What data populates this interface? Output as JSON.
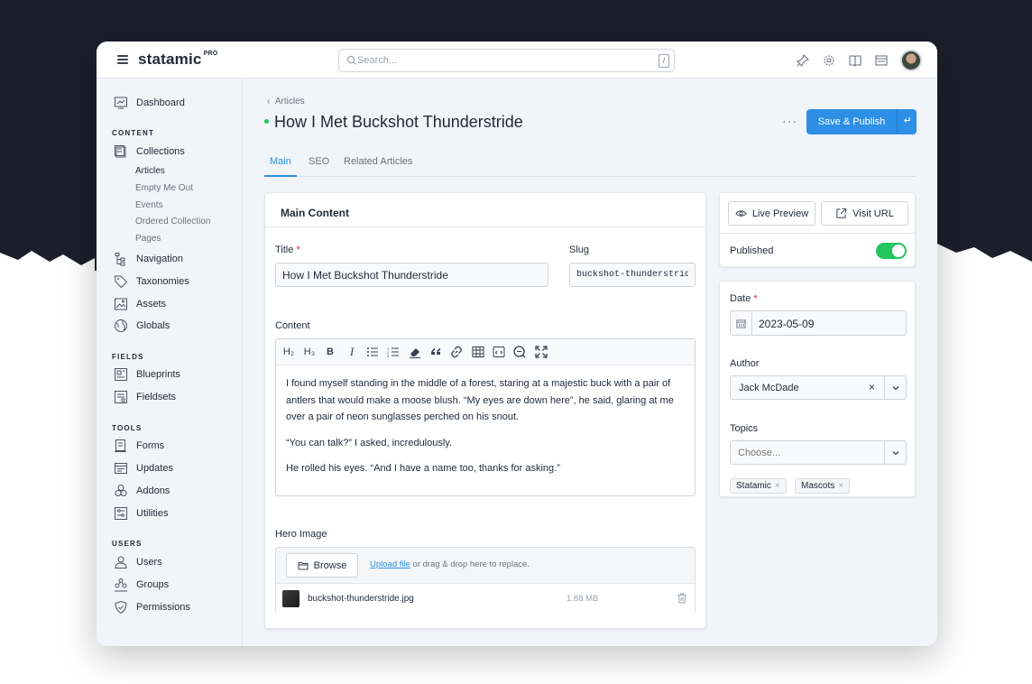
{
  "brand": {
    "name": "statamic",
    "edition": "PRO"
  },
  "search": {
    "placeholder": "Search...",
    "shortcut": "/"
  },
  "header": {
    "icons": [
      "pin-icon",
      "gear-icon",
      "book-icon",
      "site-icon",
      "avatar"
    ]
  },
  "sidebar": {
    "dashboard": "Dashboard",
    "sections": {
      "content": "CONTENT",
      "fields": "FIELDS",
      "tools": "TOOLS",
      "users": "USERS"
    },
    "collections": "Collections",
    "collection_items": [
      "Articles",
      "Empty Me Out",
      "Events",
      "Ordered Collection",
      "Pages"
    ],
    "navigation": "Navigation",
    "taxonomies": "Taxonomies",
    "assets": "Assets",
    "globals": "Globals",
    "blueprints": "Blueprints",
    "fieldsets": "Fieldsets",
    "forms": "Forms",
    "updates": "Updates",
    "addons": "Addons",
    "utilities": "Utilities",
    "users": "Users",
    "groups": "Groups",
    "permissions": "Permissions"
  },
  "page": {
    "breadcrumb": "Articles",
    "title": "How I Met Buckshot Thunderstride",
    "more": "···",
    "publish_label": "Save & Publish",
    "status_color": "#22c55e"
  },
  "tabs": [
    "Main",
    "SEO",
    "Related Articles"
  ],
  "main_card": {
    "title": "Main Content",
    "title_label": "Title",
    "title_value": "How I Met Buckshot Thunderstride",
    "slug_label": "Slug",
    "slug_value": "buckshot-thunderstride",
    "content_label": "Content",
    "toolbar_labels": [
      "H₂",
      "H₃",
      "B",
      "I"
    ],
    "paragraphs": [
      "I found myself standing in the middle of a forest, staring at a majestic buck with a pair of antlers that would make a moose blush. “My eyes are down here”, he said, glaring at me over a pair of neon sunglasses perched on his snout.",
      "“You can talk?” I asked, incredulously.",
      "He rolled his eyes. “And I have a name too, thanks for asking.”"
    ],
    "hero_label": "Hero Image",
    "browse_label": "Browse",
    "upload_link": "Upload file",
    "upload_rest": " or drag & drop here to replace.",
    "asset_name": "buckshot-thunderstride.jpg",
    "asset_size": "1.88 MB"
  },
  "side_card": {
    "live_preview": "Live Preview",
    "visit_url": "Visit URL",
    "published_label": "Published",
    "published": true,
    "toggle_color": "#22c55e"
  },
  "meta_card": {
    "date_label": "Date",
    "date_value": "2023-05-09",
    "author_label": "Author",
    "author_value": "Jack McDade",
    "topics_label": "Topics",
    "topics_placeholder": "Choose...",
    "topics": [
      "Statamic",
      "Mascots"
    ]
  },
  "colors": {
    "accent": "#2d8fe5",
    "background_dark": "#1c1f2b"
  }
}
